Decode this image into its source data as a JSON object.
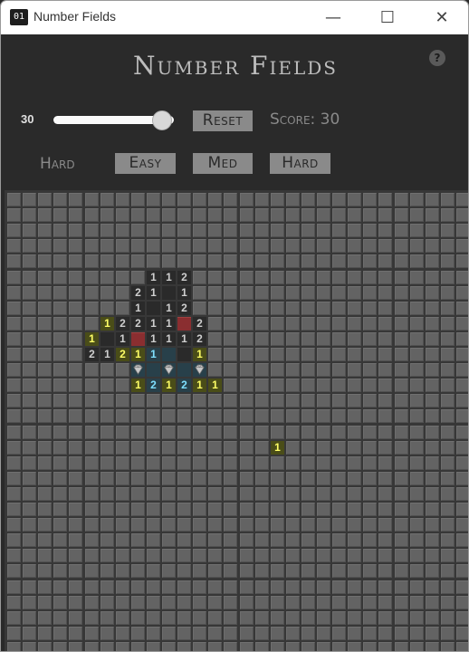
{
  "window": {
    "title": "Number Fields",
    "icon_text": "01",
    "minimize_label": "—",
    "maximize_label": "☐",
    "close_label": "✕"
  },
  "app": {
    "title": "Number Fields",
    "help_label": "?"
  },
  "controls": {
    "slider_value": "30",
    "slider_fraction": 0.9,
    "reset_label": "Reset",
    "score_text": "Score: 30",
    "difficulty_current": "Hard",
    "easy_label": "Easy",
    "med_label": "Med",
    "hard_label": "Hard"
  },
  "board": {
    "columns": 30,
    "rows": 30,
    "revealed_cells": [
      {
        "col": 9,
        "row": 5,
        "text": "1"
      },
      {
        "col": 10,
        "row": 5,
        "text": "1"
      },
      {
        "col": 11,
        "row": 5,
        "text": "2"
      },
      {
        "col": 8,
        "row": 6,
        "text": "2"
      },
      {
        "col": 9,
        "row": 6,
        "text": "1"
      },
      {
        "col": 10,
        "row": 6,
        "text": ""
      },
      {
        "col": 11,
        "row": 6,
        "text": "1"
      },
      {
        "col": 8,
        "row": 7,
        "text": "1"
      },
      {
        "col": 9,
        "row": 7,
        "text": ""
      },
      {
        "col": 10,
        "row": 7,
        "text": "1"
      },
      {
        "col": 11,
        "row": 7,
        "text": "2"
      },
      {
        "col": 6,
        "row": 8,
        "text": "1",
        "hl": "y"
      },
      {
        "col": 7,
        "row": 8,
        "text": "2"
      },
      {
        "col": 8,
        "row": 8,
        "text": "2"
      },
      {
        "col": 9,
        "row": 8,
        "text": "1"
      },
      {
        "col": 10,
        "row": 8,
        "text": "1"
      },
      {
        "col": 12,
        "row": 8,
        "text": "2"
      },
      {
        "col": 5,
        "row": 9,
        "text": "1",
        "hl": "y"
      },
      {
        "col": 6,
        "row": 9,
        "text": ""
      },
      {
        "col": 7,
        "row": 9,
        "text": "1"
      },
      {
        "col": 9,
        "row": 9,
        "text": "1"
      },
      {
        "col": 10,
        "row": 9,
        "text": "1"
      },
      {
        "col": 11,
        "row": 9,
        "text": "1"
      },
      {
        "col": 12,
        "row": 9,
        "text": "2"
      },
      {
        "col": 5,
        "row": 10,
        "text": "2"
      },
      {
        "col": 6,
        "row": 10,
        "text": "1"
      },
      {
        "col": 7,
        "row": 10,
        "text": "2",
        "hl": "y"
      },
      {
        "col": 8,
        "row": 10,
        "text": "1",
        "hl": "y"
      },
      {
        "col": 9,
        "row": 10,
        "text": "1",
        "hl": "c"
      },
      {
        "col": 10,
        "row": 10,
        "text": "",
        "hl": "c"
      },
      {
        "col": 11,
        "row": 10,
        "text": ""
      },
      {
        "col": 12,
        "row": 10,
        "text": "1",
        "hl": "y"
      },
      {
        "col": 8,
        "row": 11,
        "text": "",
        "hl": "c"
      },
      {
        "col": 9,
        "row": 11,
        "text": "",
        "hl": "c"
      },
      {
        "col": 10,
        "row": 11,
        "text": "",
        "hl": "c"
      },
      {
        "col": 11,
        "row": 11,
        "text": "",
        "hl": "c"
      },
      {
        "col": 12,
        "row": 11,
        "text": "",
        "hl": "c"
      },
      {
        "col": 8,
        "row": 12,
        "text": "1",
        "hl": "y"
      },
      {
        "col": 9,
        "row": 12,
        "text": "2",
        "hl": "c"
      },
      {
        "col": 10,
        "row": 12,
        "text": "1",
        "hl": "y"
      },
      {
        "col": 11,
        "row": 12,
        "text": "2",
        "hl": "c"
      },
      {
        "col": 12,
        "row": 12,
        "text": "1",
        "hl": "y"
      },
      {
        "col": 13,
        "row": 12,
        "text": "1",
        "hl": "y"
      },
      {
        "col": 17,
        "row": 16,
        "text": "1",
        "hl": "y"
      }
    ],
    "flagged_cells": [
      {
        "col": 8,
        "row": 9
      },
      {
        "col": 11,
        "row": 8
      }
    ],
    "gem_cells": [
      {
        "col": 8,
        "row": 11
      },
      {
        "col": 10,
        "row": 11
      },
      {
        "col": 12,
        "row": 11
      }
    ]
  }
}
